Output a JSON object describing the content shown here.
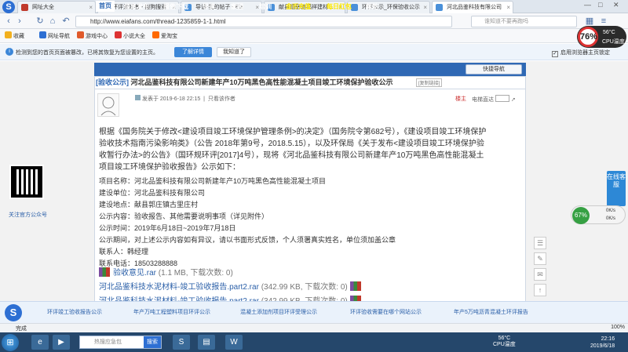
{
  "browser": {
    "tabs": [
      {
        "label": "网址大全",
        "active": false
      },
      {
        "label": "环评爱好者 - 搜狗搜索",
        "active": false
      },
      {
        "label": "导读-我的帖子 - Eia",
        "active": false
      },
      {
        "label": "献县德岳驰福祥建材…",
        "active": false
      },
      {
        "label": "环评公示_环保验收公示",
        "active": false
      },
      {
        "label": "河北品鉴科技有限公司",
        "active": true
      }
    ],
    "url": "http://www.eiafans.com/thread-1235859-1-1.html",
    "search_placeholder": "谁知道不要再跑吗",
    "bookmarks": [
      "收藏",
      "网址导航",
      "游戏中心",
      "小说大全",
      "爱淘宝"
    ],
    "notice": {
      "text": "检测到您的首页页面被篡改，已将其恢复为您设置的主页。",
      "primary": "了解详情",
      "secondary": "我知道了",
      "checkbox": "启用浏览器主页锁定"
    },
    "gauge": {
      "percent": "76%",
      "temp": "56°C",
      "label": "CPU温度"
    }
  },
  "site": {
    "menu": [
      "首页",
      "信息发布",
      "报告下载",
      "导读",
      "家园",
      "培训",
      "金币充值",
      "每日红包",
      "帮助"
    ],
    "quick_nav": "快捷导航"
  },
  "post": {
    "title_prefix": "[验收公示]",
    "title": "河北品鉴科技有限公司新建年产10万吨黑色高性能混凝土项目竣工环境保护验收公示",
    "copy_link": "[复制链接]",
    "meta_time": "发表于 2019-6-18 22:15",
    "meta_author_only": "只看该作者",
    "louzhu": "楼主",
    "elevator": "电梯直达",
    "paragraph_lines": [
      "根据《国务院关于修改<建设项目竣工环境保护管理条例>的决定》（国务院令第682号），《建设项目竣工环境保护",
      "验收技术指南污染影响类》（公告 2018年第9号，2018.5.15），以及环保局《关于发布<建设项目竣工环境保护验",
      "收暂行办法>的公告》（国环规环评[2017]4号），现将《河北品鉴科技有限公司新建年产10万吨黑色高性能混凝土",
      "项目竣工环境保护验收报告》公示如下："
    ],
    "details": [
      "项目名称：河北品鉴科技有限公司新建年产10万吨黑色高性能混凝土项目",
      "建设单位：河北品鉴科技有限公司",
      "建设地点：献县郭庄镇古里庄村",
      "公示内容：验收报告、其他需要说明事项（详见附件）",
      "公示时间：2019年6月18日~2019年7月18日",
      "公示期间，对上述公示内容如有异议，请以书面形式反馈，个人须署真实姓名，单位须加盖公章",
      "联系人：韩经理",
      "联系电话：18503288888"
    ],
    "attachments": [
      {
        "name": "验收意见.rar",
        "meta": "(1.1 MB, 下载次数: 0)"
      },
      {
        "name": "河北品鉴科技水泥材料-竣工验收报告.part2.rar",
        "meta": "(342.99 KB, 下载次数: 0)"
      },
      {
        "name": "河北品鉴科技水泥材料-竣工验收报告.part2.rar",
        "meta": "(342.99 KB, 下载次数: 0)"
      }
    ]
  },
  "sidebar": {
    "qr_label": "关注官方公众号",
    "float_panel": "在线客服",
    "net_percent": "67%",
    "net_up": "0K/s",
    "net_down": "0K/s"
  },
  "ribbon": {
    "links": [
      "环评竣工验收报告公示",
      "年产万吨工程塑料项目环评公示",
      "混凝土添加剂项目环评受理公示",
      "环评验收需要在哪个网站公示",
      "年产5万吨沥青混凝土环评报告"
    ]
  },
  "status": {
    "left": "完成",
    "zoom": "100%"
  },
  "taskbar": {
    "search_placeholder": "热搜应急包",
    "search_button": "搜索",
    "temp": "56°C",
    "temp_label": "CPU温度",
    "time": "22:16",
    "date": "2019/6/18"
  }
}
